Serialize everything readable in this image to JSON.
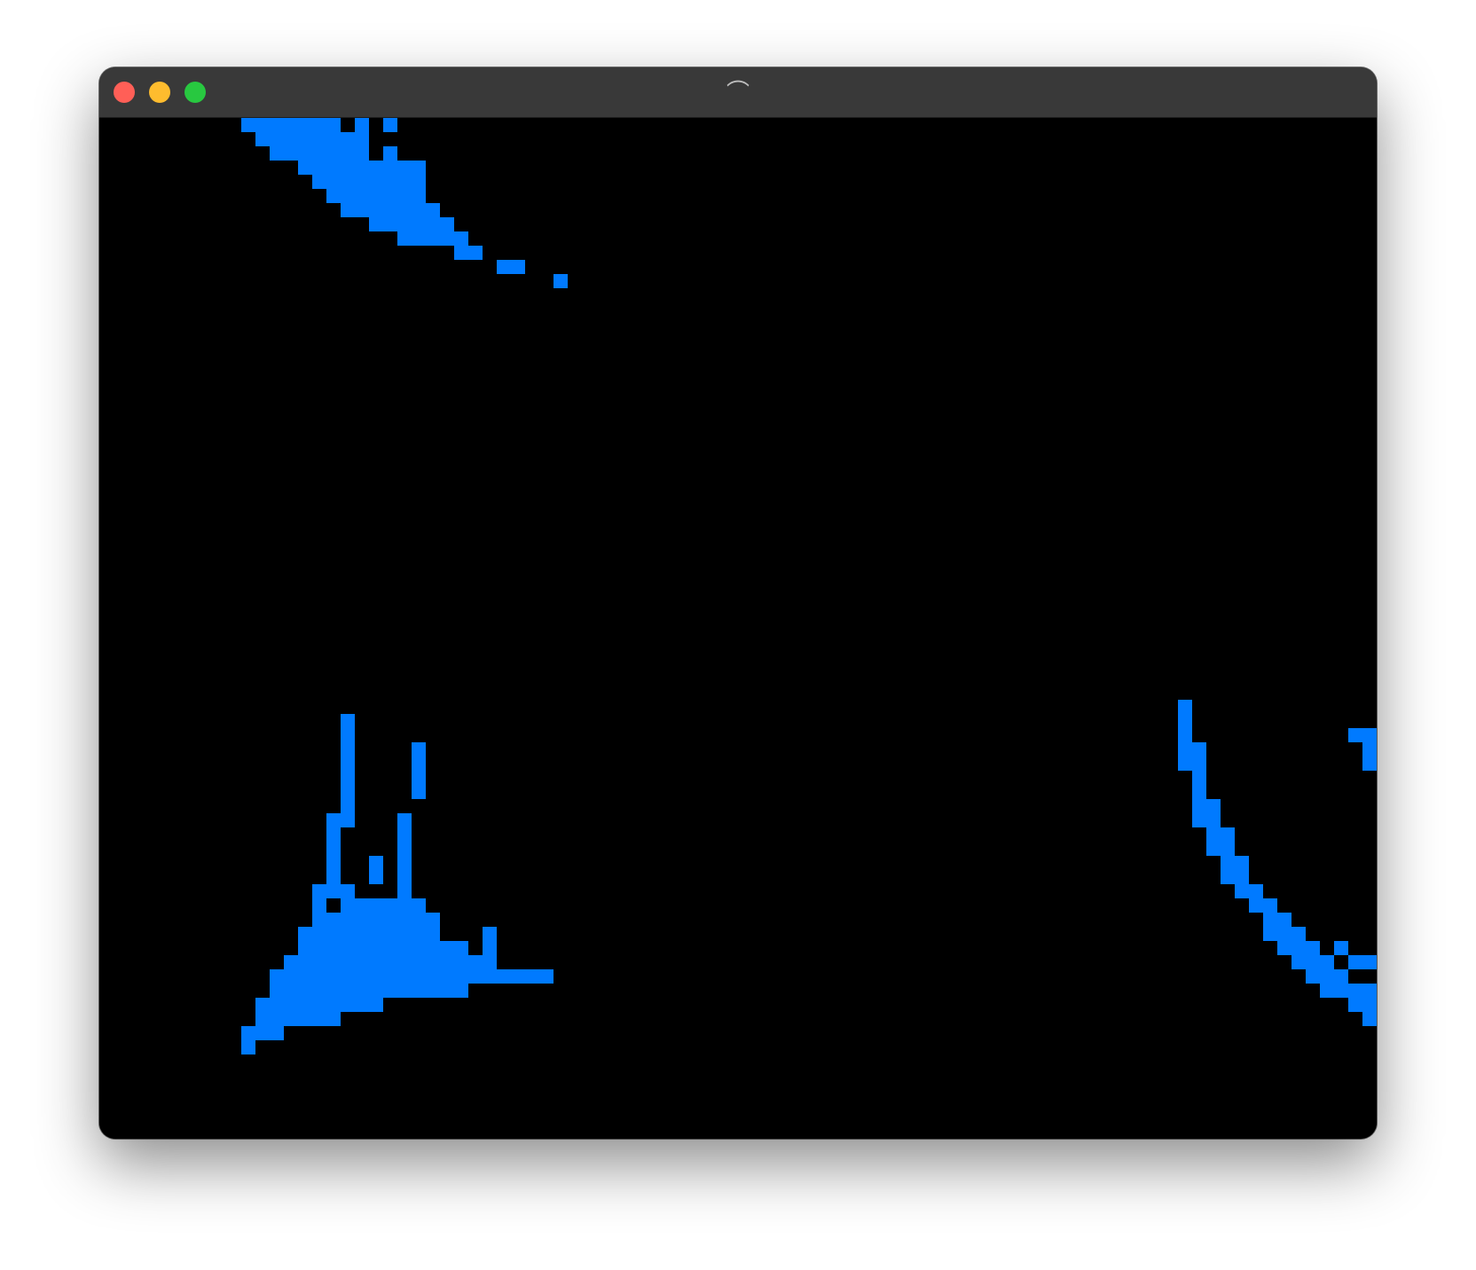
{
  "window": {
    "title_glyph": "⌒",
    "background_color": "#000000",
    "titlebar_color": "#393939"
  },
  "traffic_lights": {
    "close_color": "#ff5f57",
    "minimize_color": "#febc2e",
    "zoom_color": "#28c840"
  },
  "game": {
    "cell_color": "#007aff"
  }
}
